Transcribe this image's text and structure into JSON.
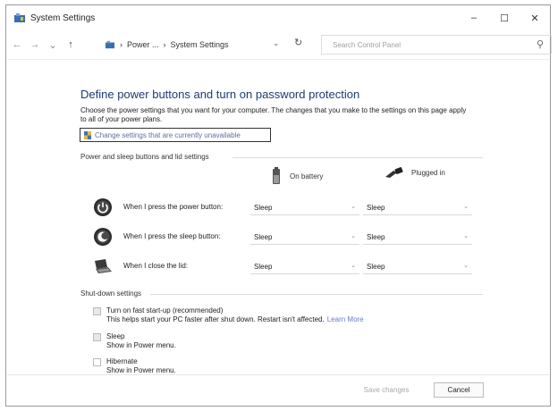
{
  "window": {
    "title": "System Settings",
    "controls": {
      "minimize": "–",
      "maximize": "☐",
      "close": "✕"
    }
  },
  "nav": {
    "back": "←",
    "forward": "→",
    "recent": "⌄",
    "up": "↑",
    "breadcrumb": [
      "Power ...",
      "System Settings"
    ],
    "breadcrumb_sep": "›",
    "dropdown": "⌄",
    "refresh": "↻",
    "search_placeholder": "Search Control Panel",
    "search_icon": "⚲"
  },
  "content": {
    "heading": "Define power buttons and turn on password protection",
    "description": "Choose the power settings that you want for your computer. The changes that you make to the settings on this page apply to all of your power plans.",
    "change_link": "Change settings that are currently unavailable",
    "section1_title": "Power and sleep buttons and lid settings",
    "col_battery": "On battery",
    "col_plugged": "Plugged in",
    "rows": [
      {
        "label": "When I press the power button:",
        "battery": "Sleep",
        "plugged": "Sleep"
      },
      {
        "label": "When I press the sleep button:",
        "battery": "Sleep",
        "plugged": "Sleep"
      },
      {
        "label": "When I close the lid:",
        "battery": "Sleep",
        "plugged": "Sleep"
      }
    ],
    "section2_title": "Shut-down settings",
    "shutdown": [
      {
        "label": "Turn on fast start-up (recommended)",
        "sub": "This helps start your PC faster after shut down. Restart isn't affected.",
        "link": "Learn More"
      },
      {
        "label": "Sleep",
        "sub": "Show in Power menu."
      },
      {
        "label": "Hibernate",
        "sub": "Show in Power menu."
      }
    ]
  },
  "footer": {
    "save": "Save changes",
    "cancel": "Cancel"
  },
  "colors": {
    "heading": "#1e3b73",
    "link": "#5b6fa3",
    "border": "#9a9a9a"
  }
}
